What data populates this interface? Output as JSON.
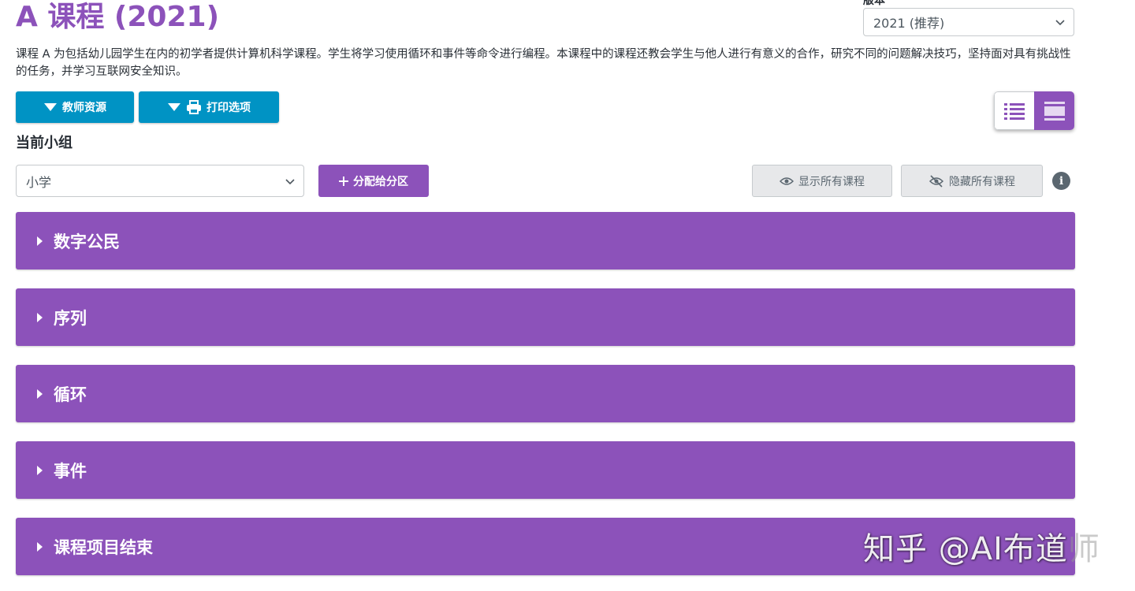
{
  "header": {
    "title": "A 课程 (2021)",
    "version_label": "版本",
    "version_value": "2021 (推荐)",
    "description": "课程 A 为包括幼儿园学生在内的初学者提供计算机科学课程。学生将学习使用循环和事件等命令进行编程。本课程中的课程还教会学生与他人进行有意义的合作，研究不同的问题解决技巧，坚持面对具有挑战性的任务，并学习互联网安全知识。"
  },
  "toolbar": {
    "teacher_resources": "教师资源",
    "print_options": "打印选项"
  },
  "group": {
    "label": "当前小组",
    "selected": "小学",
    "assign_button": "分配给分区",
    "show_all": "显示所有课程",
    "hide_all": "隐藏所有课程"
  },
  "units": [
    {
      "label": "数字公民"
    },
    {
      "label": "序列"
    },
    {
      "label": "循环"
    },
    {
      "label": "事件"
    },
    {
      "label": "课程项目结束"
    }
  ],
  "watermark": {
    "text": "知乎 @AI布道",
    "tail": "师"
  },
  "colors": {
    "accent": "#8c52ba",
    "teal": "#0093c4"
  },
  "icons": [
    "chevron-down-icon",
    "caret-down-icon",
    "printer-icon",
    "list-view-icon",
    "card-view-icon",
    "plus-icon",
    "eye-icon",
    "eye-slash-icon",
    "info-icon",
    "caret-right-icon"
  ]
}
